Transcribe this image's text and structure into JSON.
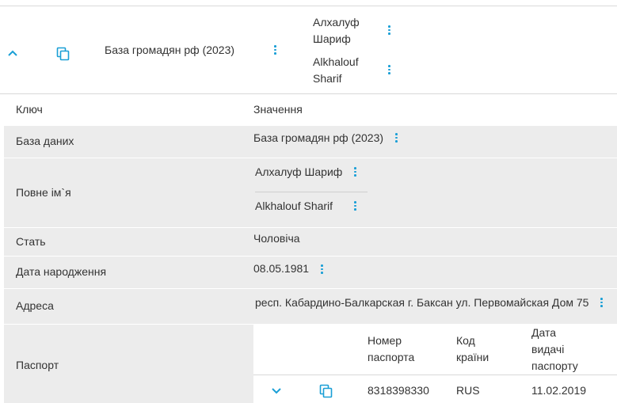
{
  "summary": {
    "database": "База громадян рф (2023)",
    "names": [
      "Алхалуф",
      "Шариф",
      "Alkhalouf",
      "Sharif"
    ]
  },
  "table": {
    "col_key": "Ключ",
    "col_value": "Значення",
    "rows": {
      "database": {
        "key": "База даних",
        "value": "База громадян рф (2023)"
      },
      "full_name": {
        "key": "Повне ім`я",
        "values": [
          "Алхалуф Шариф",
          "Alkhalouf Sharif"
        ]
      },
      "sex": {
        "key": "Стать",
        "value": "Чоловіча"
      },
      "birth_date": {
        "key": "Дата народження",
        "value": "08.05.1981"
      },
      "address": {
        "key": "Адреса",
        "value": "респ. Кабардино-Балкарская г. Баксан ул. Первомайская Дом 75"
      },
      "passport": {
        "key": "Паспорт"
      }
    }
  },
  "passport_table": {
    "headers": {
      "number": [
        "Номер",
        "паспорта"
      ],
      "country": [
        "Код",
        "країни"
      ],
      "issue_date": [
        "Дата",
        "видачі",
        "паспорту"
      ]
    },
    "row": {
      "number": "8318398330",
      "country": "RUS",
      "issue_date": "11.02.2019"
    }
  },
  "icons": {
    "collapse": "chevron-up-icon",
    "expand": "chevron-down-icon",
    "copy": "copy-icon",
    "menu": "more-vertical-icon"
  },
  "colors": {
    "accent": "#1a9fd6",
    "row_gray": "#ececec",
    "divider": "#d9d9d9",
    "text": "#333333"
  }
}
